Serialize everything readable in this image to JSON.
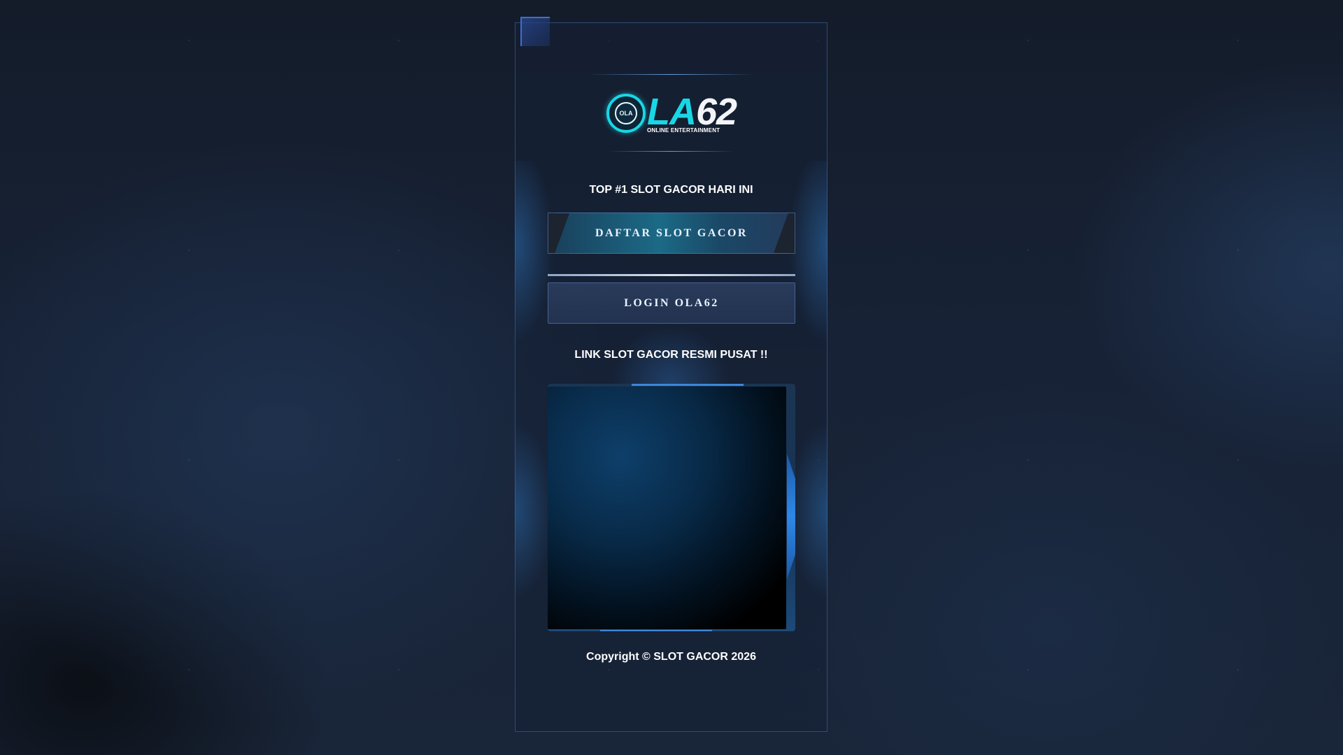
{
  "header": {
    "logo": {
      "brand_prefix": "OLA",
      "brand_main": "LA",
      "brand_number": "62",
      "emblem_text": "OLA",
      "subtitle": "ONLINE ENTERTAINMENT",
      "colors": {
        "accent": "#19d6e6",
        "number": "#f2f4f7"
      }
    }
  },
  "main": {
    "tagline": "TOP #1 SLOT GACOR HARI INI",
    "register_button_label": "DAFTAR SLOT GACOR",
    "login_button_label": "LOGIN OLA62",
    "link_title": "LINK SLOT GACOR RESMI PUSAT !!"
  },
  "footer": {
    "copyright": "Copyright © SLOT GACOR 2026"
  },
  "theme": {
    "background": "#172236",
    "panel_border": "#466eaa",
    "accent_blue": "#3c86d8"
  }
}
